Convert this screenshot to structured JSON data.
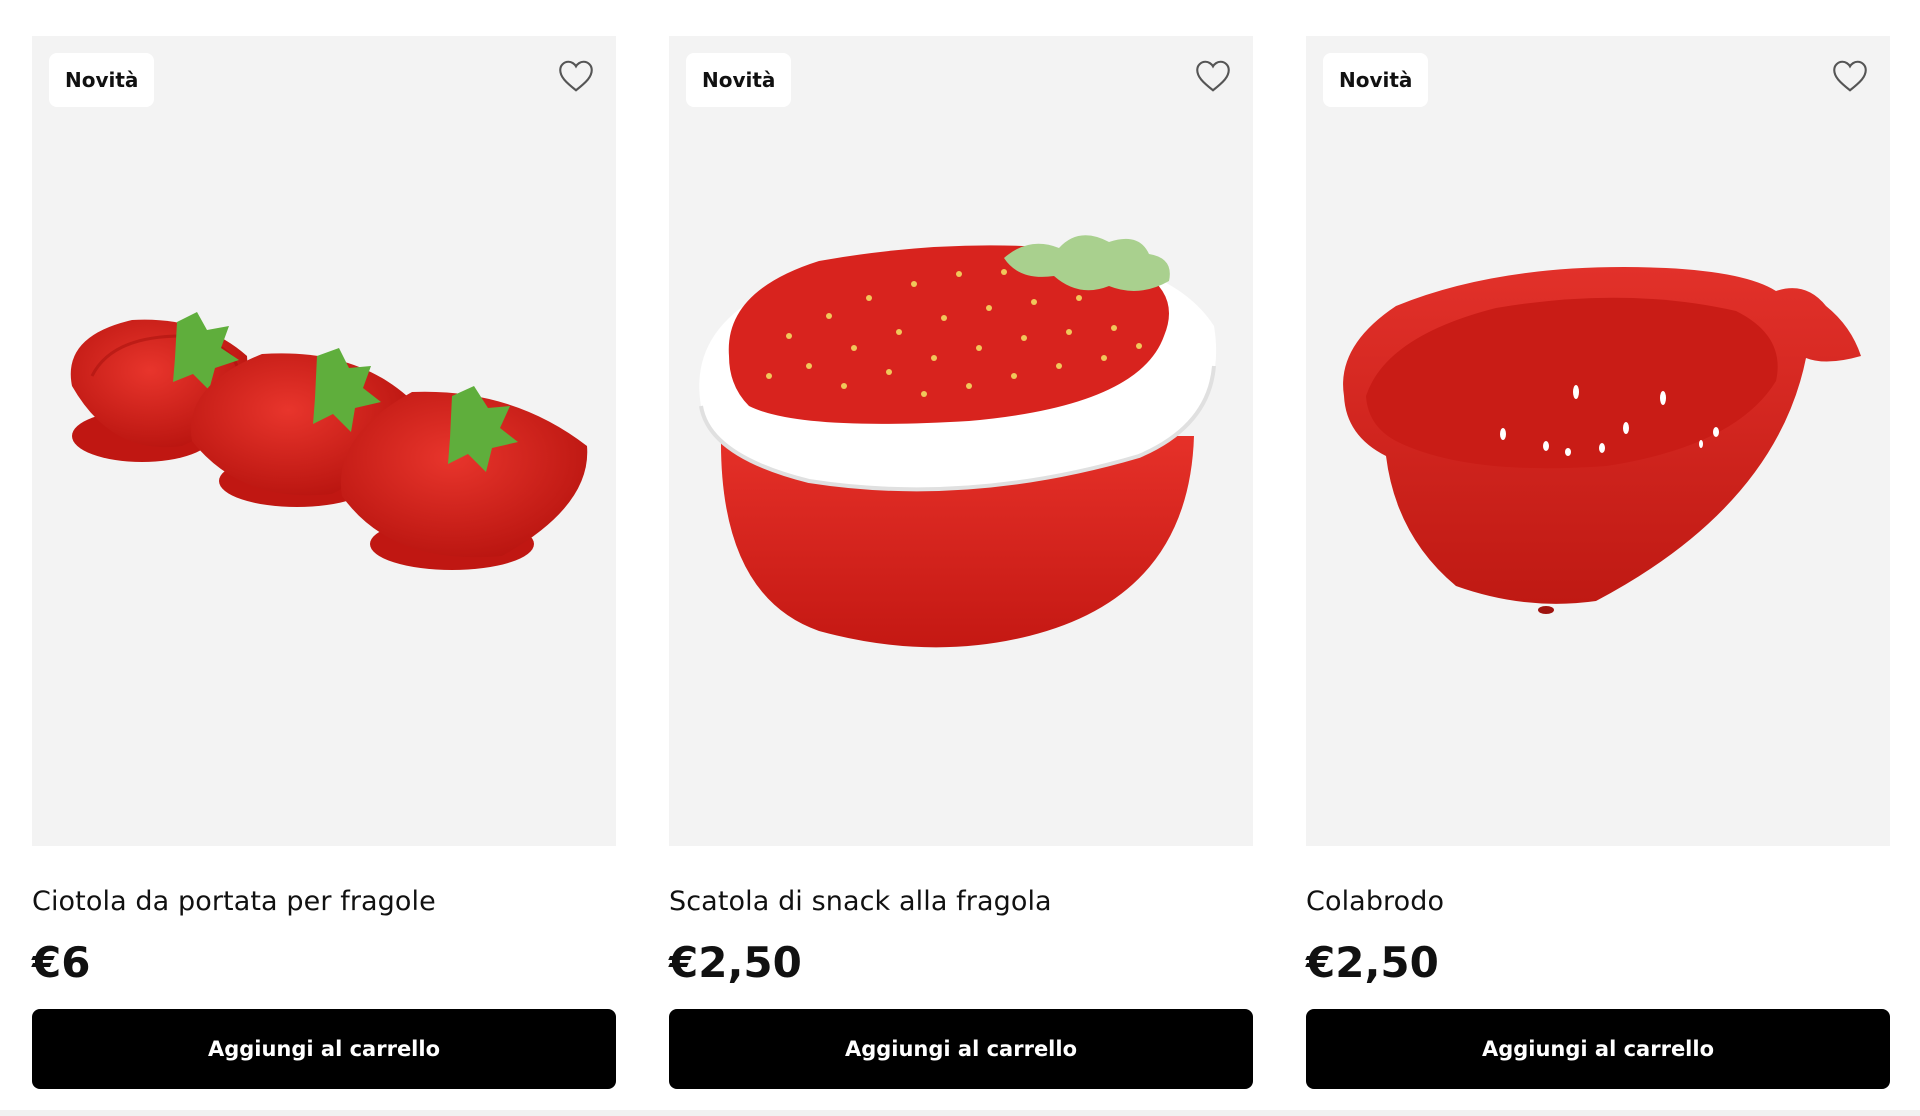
{
  "products": [
    {
      "badge": "Novità",
      "title": "Ciotola da portata per fragole",
      "price": "€6",
      "button": "Aggiungi al carrello",
      "image_icon": "strawberry-serving-bowl-image"
    },
    {
      "badge": "Novità",
      "title": "Scatola di snack alla fragola",
      "price": "€2,50",
      "button": "Aggiungi al carrello",
      "image_icon": "strawberry-snack-box-image"
    },
    {
      "badge": "Novità",
      "title": "Colabrodo",
      "price": "€2,50",
      "button": "Aggiungi al carrello",
      "image_icon": "strawberry-colander-image"
    }
  ],
  "colors": {
    "product_red": "#d8231e",
    "leaf_green": "#5fae3c",
    "button_black": "#000000",
    "card_bg": "#f3f3f3"
  }
}
